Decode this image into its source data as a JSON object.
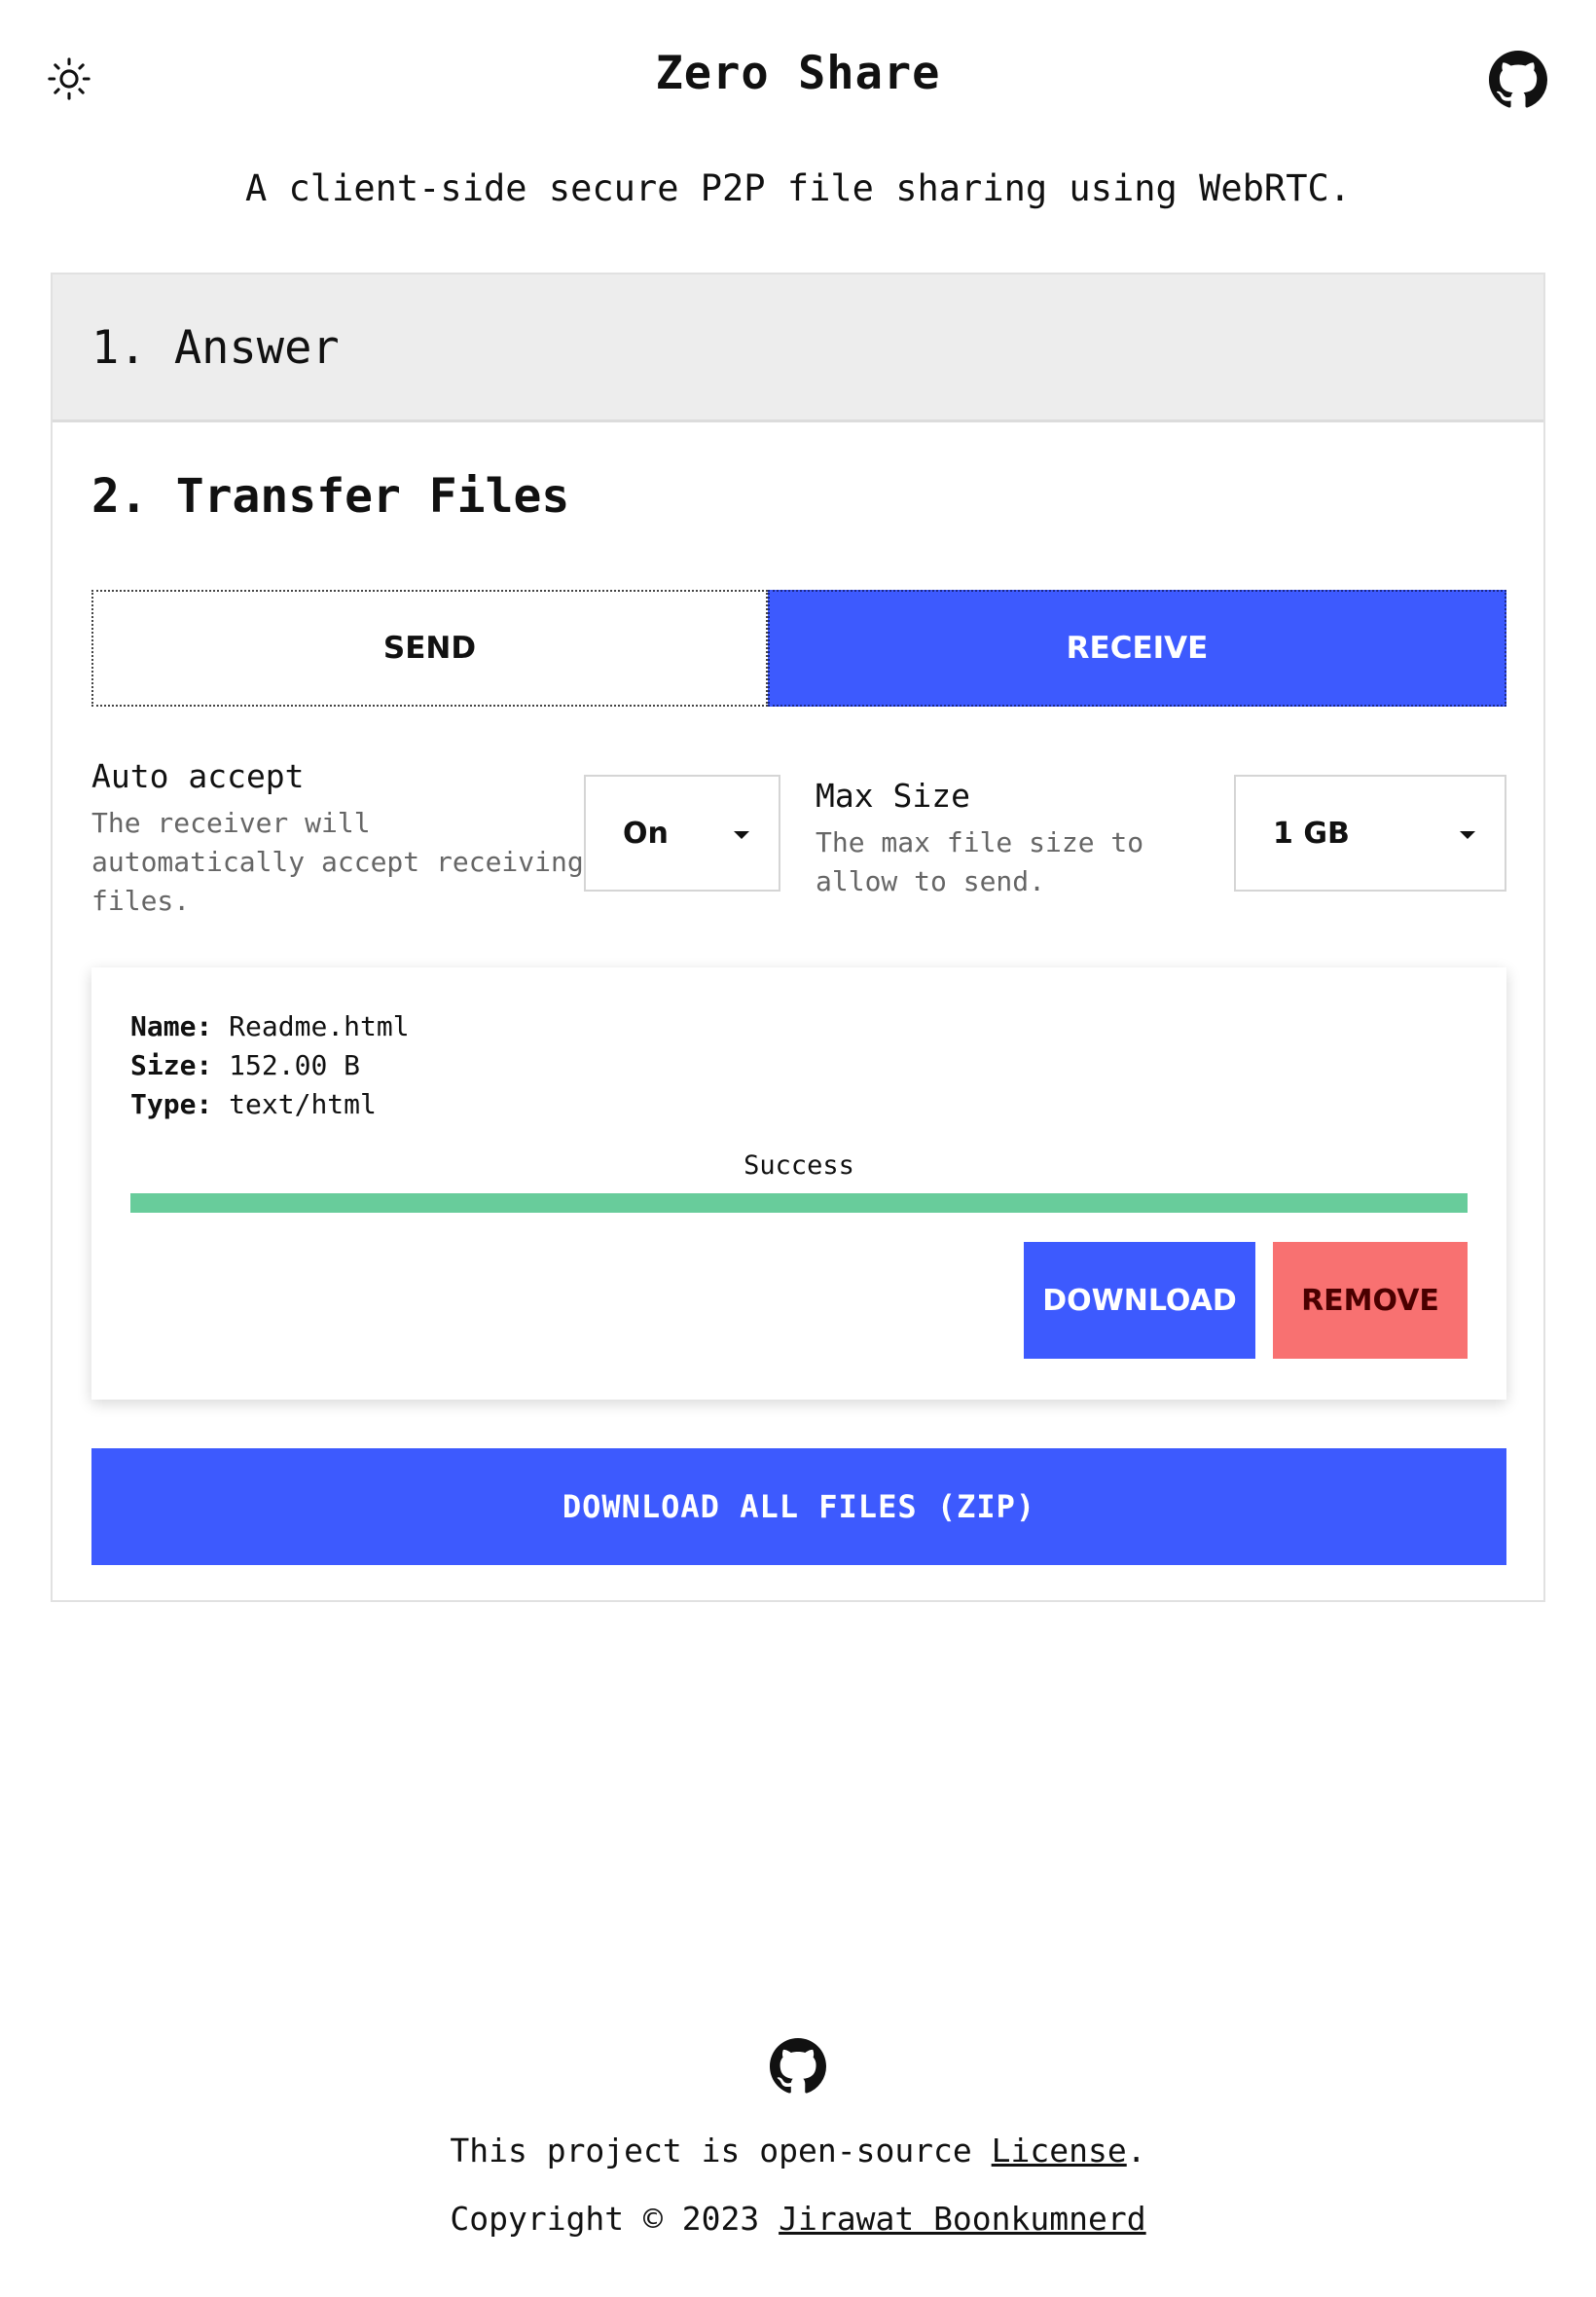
{
  "header": {
    "theme_toggle_icon": "sun-icon",
    "title": "Zero Share",
    "github_icon": "github-icon"
  },
  "subtitle": "A client-side secure P2P file sharing using WebRTC.",
  "steps": {
    "step1": "1. Answer",
    "step2": "2. Transfer Files"
  },
  "tabs": {
    "send": "SEND",
    "receive": "RECEIVE",
    "active": "receive"
  },
  "settings": {
    "auto_accept": {
      "label": "Auto accept",
      "desc_line1": "The receiver will",
      "desc_line2": "automatically accept receiving",
      "desc_line3": "files.",
      "value": "On"
    },
    "max_size": {
      "label": "Max Size",
      "desc_line1": "The max file size to",
      "desc_line2": "allow to send.",
      "value": "1 GB"
    }
  },
  "file": {
    "name_label": "Name:",
    "name": "Readme.html",
    "size_label": "Size:",
    "size": "152.00 B",
    "type_label": "Type:",
    "type": "text/html",
    "status": "Success",
    "progress": 1.0,
    "download_label": "DOWNLOAD",
    "remove_label": "REMOVE"
  },
  "download_all_label": "DOWNLOAD ALL FILES (ZIP)",
  "footer": {
    "line1_prefix": "This project is open-source",
    "license_link": "License",
    "line1_suffix": ".",
    "copyright": "Copyright © 2023",
    "author_link": "Jirawat Boonkumnerd"
  },
  "colors": {
    "accent": "#3d5afe",
    "success": "#68cc9b",
    "danger": "#f87171"
  }
}
